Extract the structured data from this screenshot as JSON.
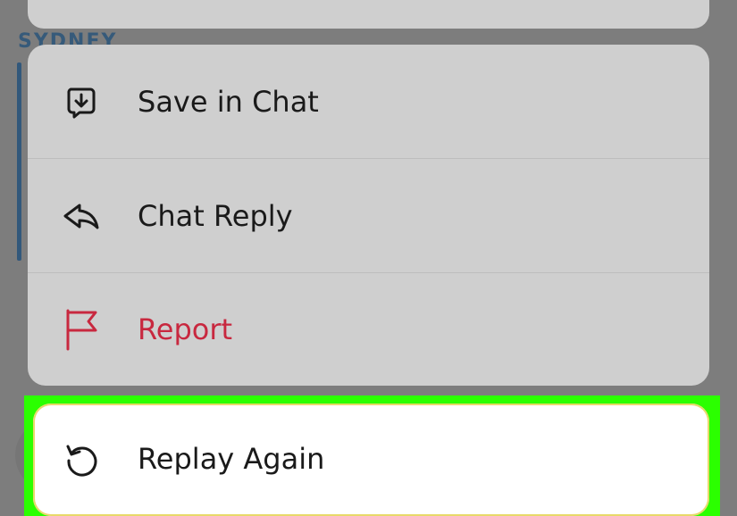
{
  "background": {
    "label": "SYDNEY"
  },
  "menu": {
    "items": [
      {
        "label": "Save in Chat",
        "icon": "save-in-chat-icon"
      },
      {
        "label": "Chat Reply",
        "icon": "reply-arrow-icon"
      },
      {
        "label": "Report",
        "icon": "flag-icon",
        "color": "#c8283f"
      }
    ]
  },
  "replay": {
    "label": "Replay Again",
    "icon": "replay-icon"
  },
  "colors": {
    "highlight": "#2bff00",
    "danger": "#c8283f",
    "menu_bg": "#cfcfcf",
    "overlay": "#7d7d7d"
  }
}
